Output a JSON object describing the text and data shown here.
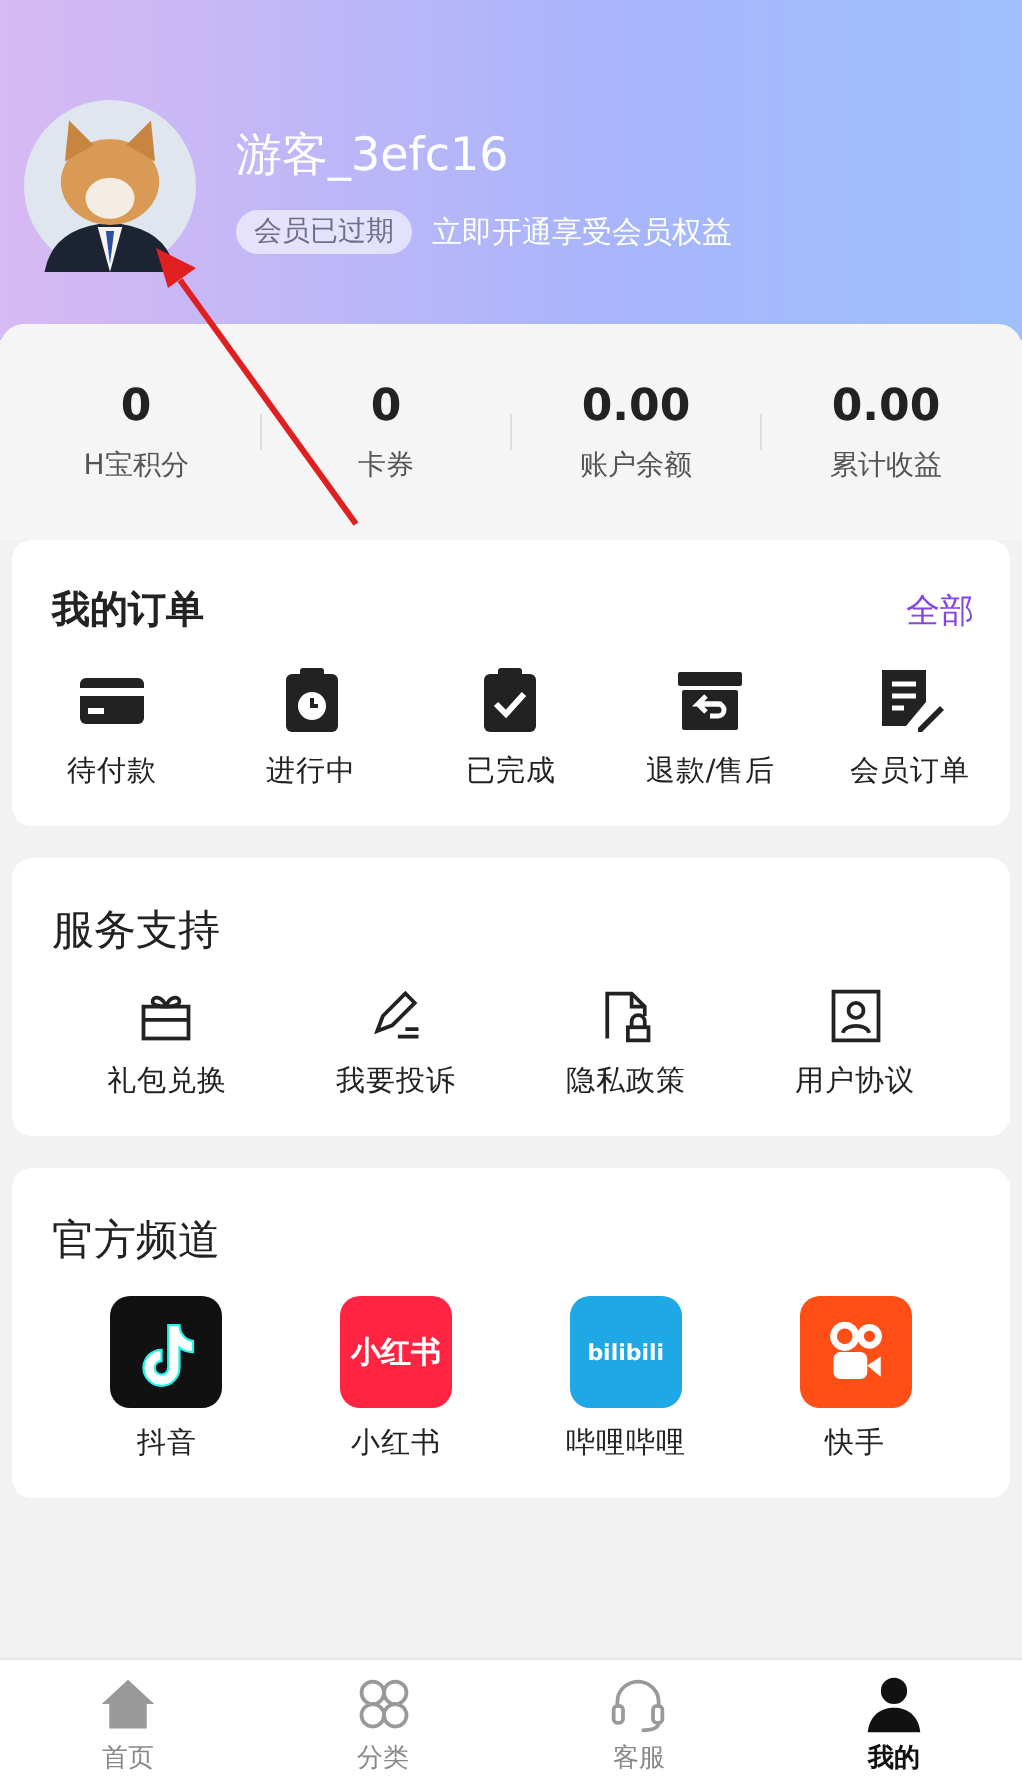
{
  "user": {
    "name": "游客_3efc16",
    "badge": "会员已过期",
    "promo": "立即开通享受会员权益"
  },
  "stats": [
    {
      "value": "0",
      "label": "H宝积分"
    },
    {
      "value": "0",
      "label": "卡券"
    },
    {
      "value": "0.00",
      "label": "账户余额"
    },
    {
      "value": "0.00",
      "label": "累计收益"
    }
  ],
  "orders": {
    "title": "我的订单",
    "link": "全部",
    "items": [
      {
        "label": "待付款",
        "kind": "card"
      },
      {
        "label": "进行中",
        "kind": "timer"
      },
      {
        "label": "已完成",
        "kind": "done"
      },
      {
        "label": "退款/售后",
        "kind": "refund"
      },
      {
        "label": "会员订单",
        "kind": "note"
      }
    ]
  },
  "services": {
    "title": "服务支持",
    "items": [
      {
        "label": "礼包兑换",
        "kind": "gift"
      },
      {
        "label": "我要投诉",
        "kind": "edit"
      },
      {
        "label": "隐私政策",
        "kind": "lock"
      },
      {
        "label": "用户协议",
        "kind": "user"
      }
    ]
  },
  "channels": {
    "title": "官方频道",
    "items": [
      {
        "label": "抖音",
        "kind": "douyin"
      },
      {
        "label": "小红书",
        "kind": "xhs",
        "logo_text": "小红书"
      },
      {
        "label": "哔哩哔哩",
        "kind": "bili",
        "logo_text": "bilibili"
      },
      {
        "label": "快手",
        "kind": "kuaishou"
      }
    ]
  },
  "nav": [
    {
      "label": "首页",
      "kind": "home",
      "selected": false
    },
    {
      "label": "分类",
      "kind": "grid",
      "selected": false
    },
    {
      "label": "客服",
      "kind": "headset",
      "selected": false
    },
    {
      "label": "我的",
      "kind": "person",
      "selected": true
    }
  ]
}
